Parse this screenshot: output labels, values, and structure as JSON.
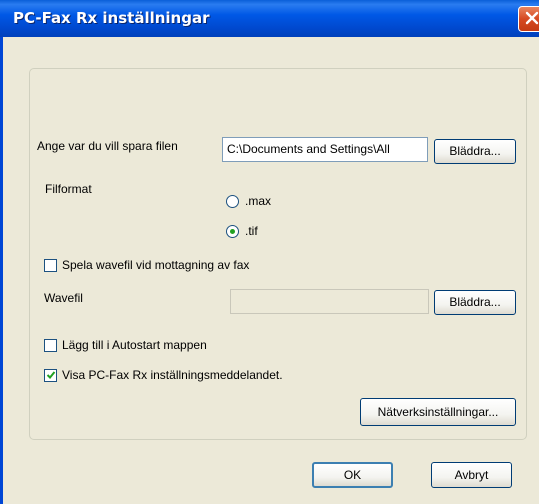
{
  "window": {
    "title": "PC-Fax Rx inställningar"
  },
  "save_location": {
    "label": "Ange var du vill spara filen",
    "path_value": "C:\\Documents and Settings\\All",
    "browse_label": "Bläddra..."
  },
  "file_format": {
    "label": "Filformat",
    "options": [
      {
        "label": ".max",
        "selected": false
      },
      {
        "label": ".tif",
        "selected": true
      }
    ]
  },
  "play_wave": {
    "label": "Spela wavefil vid mottagning av fax",
    "checked": false
  },
  "wave_file": {
    "label": "Wavefil",
    "value": "",
    "browse_label": "Bläddra..."
  },
  "autostart": {
    "label": "Lägg till i Autostart mappen",
    "checked": false
  },
  "show_message": {
    "label": "Visa PC-Fax Rx inställningsmeddelandet.",
    "checked": true
  },
  "network_settings_label": "Nätverksinställningar...",
  "ok_label": "OK",
  "cancel_label": "Avbryt"
}
